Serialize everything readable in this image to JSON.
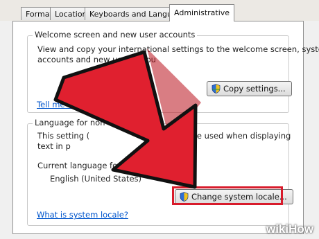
{
  "tabs": [
    {
      "label": "Formats"
    },
    {
      "label": "Location"
    },
    {
      "label": "Keyboards and Languages"
    },
    {
      "label": "Administrative"
    }
  ],
  "welcome": {
    "title": "Welcome screen and new user accounts",
    "desc_line1": "View and copy your international settings to the welcome screen, system",
    "desc_line2": "accounts and new user accou",
    "copy_button": "Copy settings...",
    "link": "Tell me more a"
  },
  "nonunicode": {
    "title": "Language for non-U",
    "desc_line1a": "This setting (",
    "desc_line1b": "guage used when displaying",
    "desc_line2a": "text in p",
    "desc_line2b": "e.",
    "current_label": "Current language for non-",
    "current_value": "English (United States)",
    "change_button": "Change system locale...",
    "link": "What is system locale?"
  },
  "colors": {
    "arrow": "#e0202f",
    "highlight": "#d81b2b",
    "link": "#0055cc"
  },
  "watermark": {
    "wiki": "wiki",
    "how": "How"
  }
}
